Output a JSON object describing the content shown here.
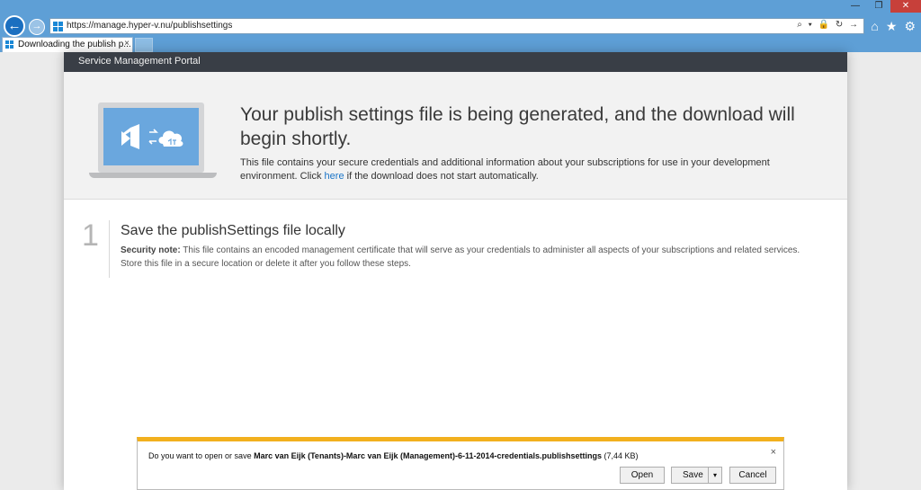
{
  "browser": {
    "url": "https://manage.hyper-v.nu/publishsettings",
    "tab_title": "Downloading the publish p...",
    "back_glyph": "←",
    "forward_glyph": "→",
    "tab_close_glyph": "×",
    "addr_tools": "⌕ ▾ 🔒 ↻ →",
    "window_buttons": {
      "minimize": "—",
      "restore": "❐",
      "close": "✕"
    },
    "toolbar_icons": {
      "home": "⌂",
      "favorites": "★",
      "settings": "⚙"
    }
  },
  "portal": {
    "title": "Service Management Portal"
  },
  "hero": {
    "title": "Your publish settings file is being generated, and the download will begin shortly.",
    "desc_before": "This file contains your secure credentials and additional information about your subscriptions for use in your development environment. Click ",
    "link": "here",
    "desc_after": " if the download does not start automatically."
  },
  "step": {
    "number": "1",
    "title": "Save the publishSettings file locally",
    "note_label": "Security note:",
    "note_text": " This file contains an encoded management certificate that will serve as your credentials to administer all aspects of your subscriptions and related services. Store this file in a secure location or delete it after you follow these steps."
  },
  "download": {
    "prompt": "Do you want to open or save ",
    "filename": "Marc van Eijk (Tenants)-Marc van Eijk (Management)-6-11-2014-credentials.publishsettings",
    "size": " (7,44 KB)",
    "close_glyph": "×",
    "open_label": "Open",
    "save_label": "Save",
    "save_arrow": "▾",
    "cancel_label": "Cancel"
  },
  "colors": {
    "chrome": "#5e9fd6",
    "portal_bar": "#393e46",
    "link": "#1a74c7",
    "download_accent": "#f2b01e"
  }
}
